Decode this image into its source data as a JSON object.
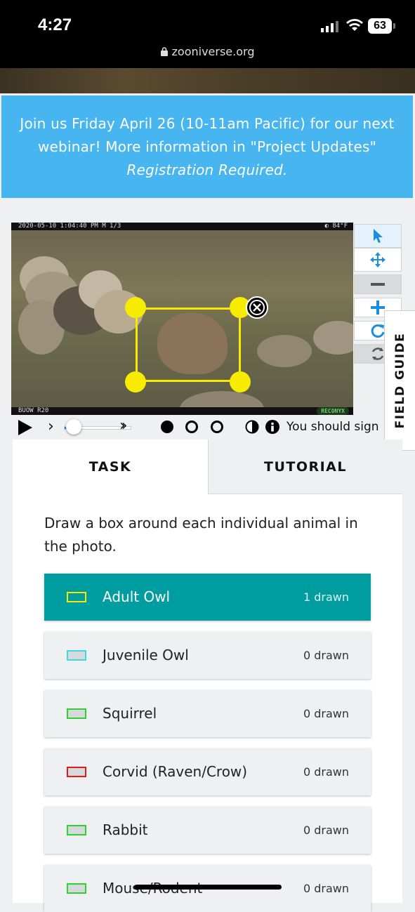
{
  "status_bar": {
    "time": "4:27",
    "battery": "63",
    "url": "zooniverse.org"
  },
  "banner": {
    "line1": "Join us Friday April 26 (10-11am Pacific) for our next",
    "line2": "webinar! More information in \"Project Updates\"",
    "line3": "Registration Required."
  },
  "camera": {
    "timestamp": "2020-05-10  1:04:40 PM   M 1/3",
    "temperature": "◐  84°F",
    "camera_id": "BUOW R20",
    "logo": "RECONYX"
  },
  "field_guide": {
    "label": "FIELD GUIDE"
  },
  "controls": {
    "progress": 0.15,
    "sign_in_notice": "You should sign"
  },
  "tabs": {
    "task": "TASK",
    "tutorial": "TUTORIAL"
  },
  "task": {
    "question": "Draw a box around each individual animal in the photo.",
    "choices": [
      {
        "label": "Adult Owl",
        "count": "1 drawn",
        "color": "#f7ec00",
        "selected": true
      },
      {
        "label": "Juvenile Owl",
        "count": "0 drawn",
        "color": "#3fd6e6"
      },
      {
        "label": "Squirrel",
        "count": "0 drawn",
        "color": "#2fd12f"
      },
      {
        "label": "Corvid (Raven/Crow)",
        "count": "0 drawn",
        "color": "#e21a1a"
      },
      {
        "label": "Rabbit",
        "count": "0 drawn",
        "color": "#2fd12f"
      },
      {
        "label": "Mouse/Rodent",
        "count": "0 drawn",
        "color": "#2fd12f"
      }
    ]
  },
  "colors": {
    "banner": "#46b5f0",
    "selected_choice": "#009da0",
    "accent": "#1a8fe0"
  }
}
